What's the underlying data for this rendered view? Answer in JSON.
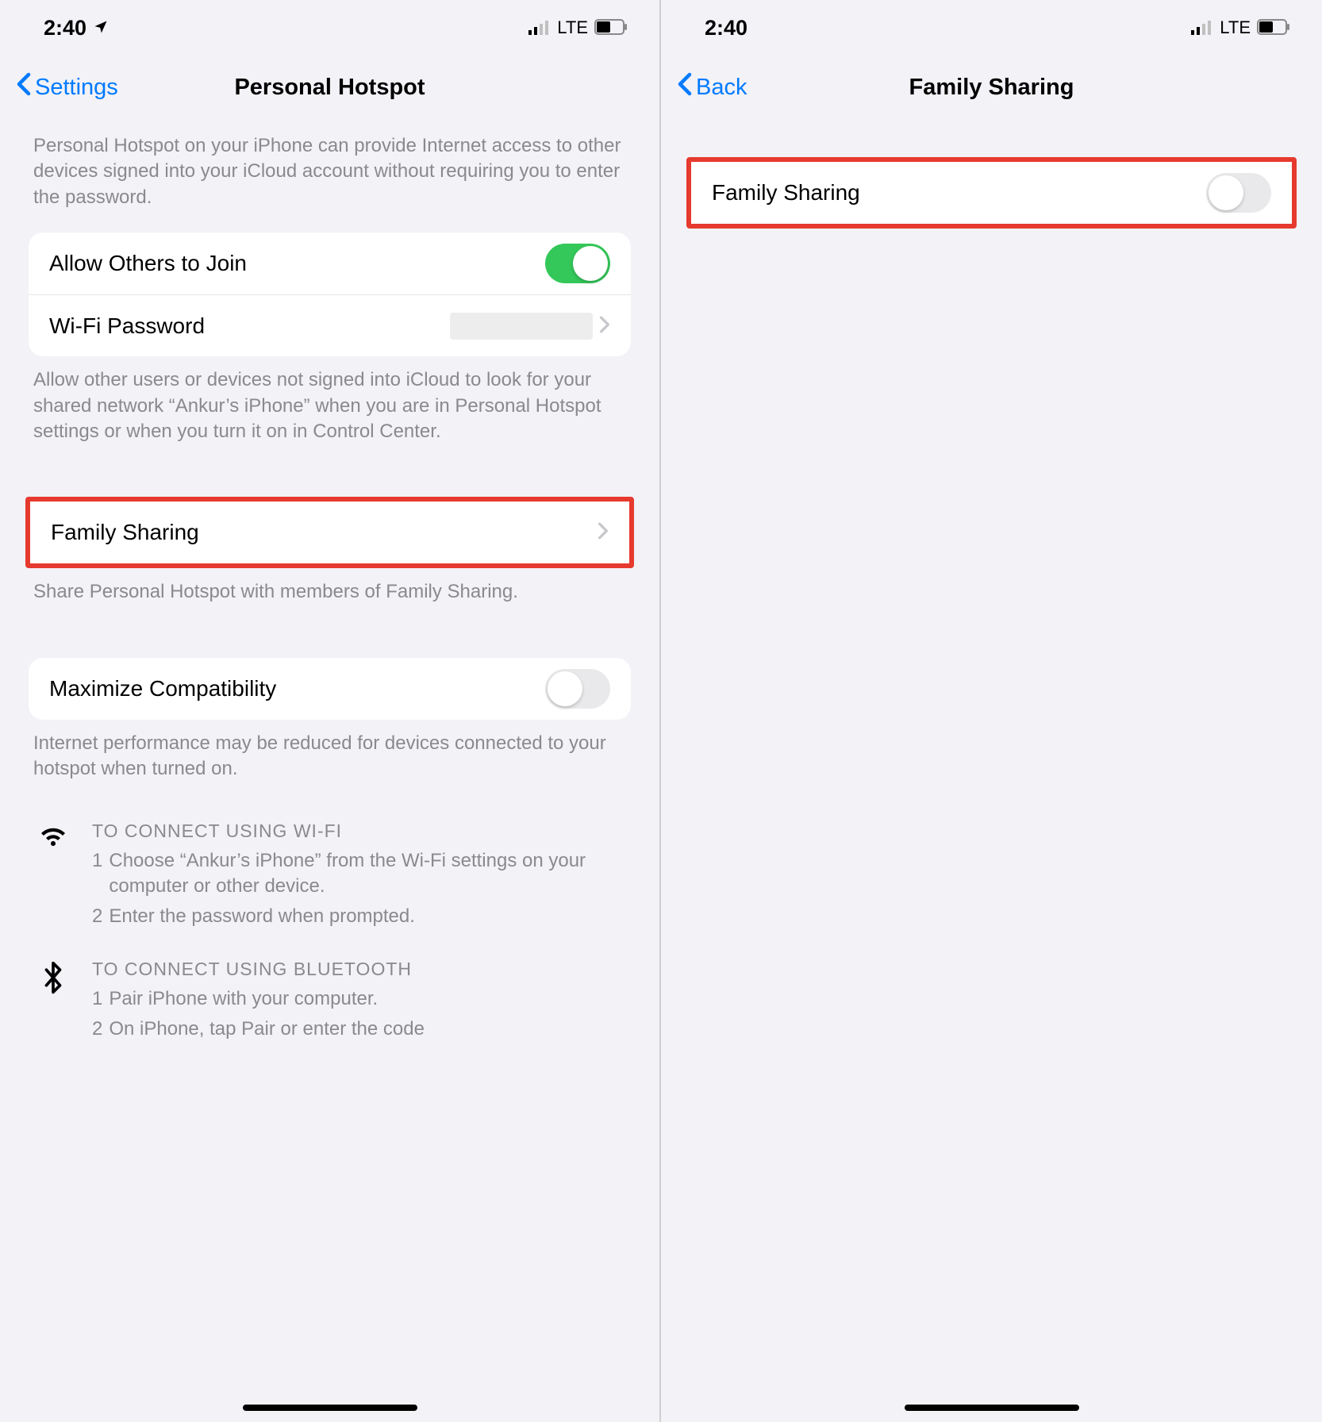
{
  "status": {
    "time": "2:40",
    "network_type": "LTE"
  },
  "left_screen": {
    "back_label": "Settings",
    "title": "Personal Hotspot",
    "intro": "Personal Hotspot on your iPhone can provide Internet access to other devices signed into your iCloud account without requiring you to enter the password.",
    "allow_others": {
      "label": "Allow Others to Join",
      "on": true
    },
    "wifi_password": {
      "label": "Wi-Fi Password"
    },
    "allow_desc": "Allow other users or devices not signed into iCloud to look for your shared network “Ankur’s iPhone” when you are in Personal Hotspot settings or when you turn it on in Control Center.",
    "family_sharing": {
      "label": "Family Sharing"
    },
    "family_desc": "Share Personal Hotspot with members of Family Sharing.",
    "maximize": {
      "label": "Maximize Compatibility",
      "on": false
    },
    "maximize_desc": "Internet performance may be reduced for devices connected to your hotspot when turned on.",
    "wifi_instructions": {
      "header": "TO CONNECT USING WI-FI",
      "step1": "Choose “Ankur’s iPhone” from the Wi-Fi settings on your computer or other device.",
      "step2": "Enter the password when prompted."
    },
    "bt_instructions": {
      "header": "TO CONNECT USING BLUETOOTH",
      "step1": "Pair iPhone with your computer.",
      "step2": "On iPhone, tap Pair or enter the code"
    }
  },
  "right_screen": {
    "back_label": "Back",
    "title": "Family Sharing",
    "family_sharing": {
      "label": "Family Sharing",
      "on": false
    }
  }
}
